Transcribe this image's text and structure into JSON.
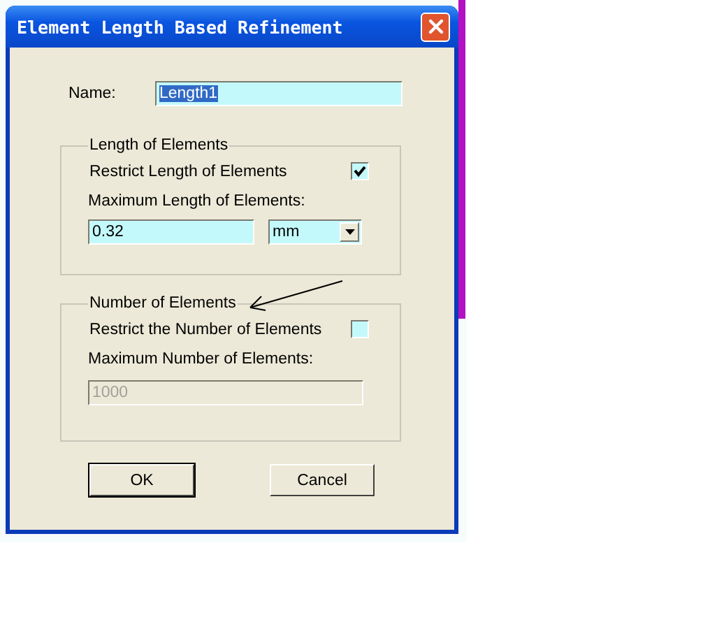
{
  "window": {
    "title": "Element Length Based Refinement"
  },
  "name_field": {
    "label": "Name:",
    "value": "Length1",
    "text_selected": true
  },
  "length_group": {
    "title": "Length of Elements",
    "restrict": {
      "label": "Restrict Length of Elements",
      "checked": true
    },
    "max_label": "Maximum Length of Elements:",
    "value": "0.32",
    "unit": "mm"
  },
  "number_group": {
    "title": "Number of Elements",
    "restrict": {
      "label": "Restrict the Number of Elements",
      "checked": false
    },
    "max_label": "Maximum Number of  Elements:",
    "value": "1000",
    "disabled": true
  },
  "buttons": [
    {
      "label": "OK",
      "default": true
    },
    {
      "label": "Cancel",
      "default": false
    }
  ]
}
